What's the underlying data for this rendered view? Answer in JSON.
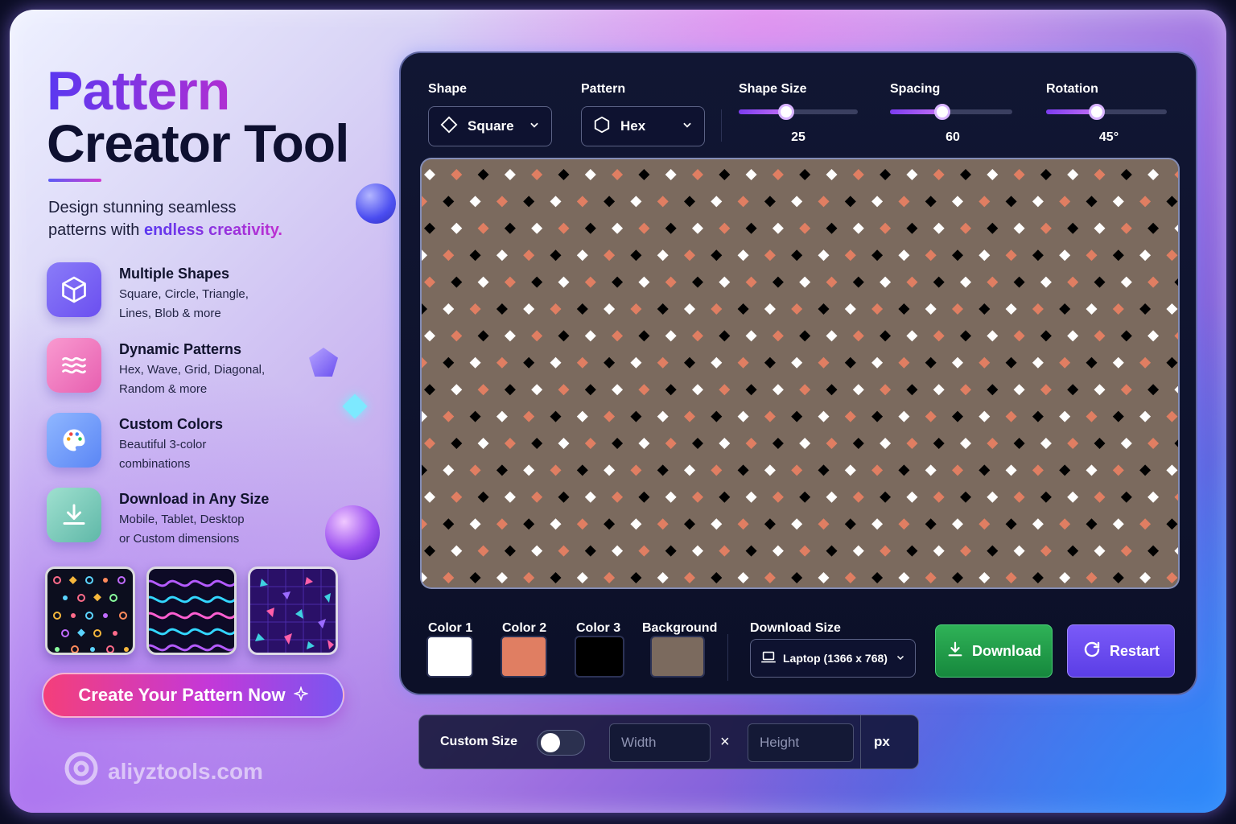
{
  "hero": {
    "title_line1": "Pattern",
    "title_line2": "Creator Tool",
    "subtitle_line1": "Design stunning seamless",
    "subtitle_line2_plain": "patterns with ",
    "subtitle_highlight": "endless creativity."
  },
  "features": [
    {
      "title": "Multiple Shapes",
      "desc1": "Square, Circle, Triangle,",
      "desc2": "Lines, Blob & more",
      "icon": "cube-icon"
    },
    {
      "title": "Dynamic Patterns",
      "desc1": "Hex, Wave, Grid, Diagonal,",
      "desc2": "Random & more",
      "icon": "waves-icon"
    },
    {
      "title": "Custom Colors",
      "desc1": "Beautiful 3-color",
      "desc2": "combinations",
      "icon": "palette-icon"
    },
    {
      "title": "Download in Any Size",
      "desc1": "Mobile, Tablet, Desktop",
      "desc2": "or Custom dimensions",
      "icon": "download-icon"
    }
  ],
  "cta_label": "Create Your Pattern Now",
  "brand": "aliyztools.com",
  "controls": {
    "shape": {
      "label": "Shape",
      "value": "Square"
    },
    "pattern": {
      "label": "Pattern",
      "value": "Hex"
    },
    "shape_size": {
      "label": "Shape Size",
      "value": "25",
      "level": 0.4
    },
    "spacing": {
      "label": "Spacing",
      "value": "60",
      "level": 0.43
    },
    "rotation": {
      "label": "Rotation",
      "value": "45°",
      "level": 0.42
    }
  },
  "colors": {
    "color1": {
      "label": "Color 1",
      "hex": "#ffffff"
    },
    "color2": {
      "label": "Color 2",
      "hex": "#e07e62"
    },
    "color3": {
      "label": "Color 3",
      "hex": "#000000"
    },
    "background": {
      "label": "Background",
      "hex": "#7b6a5e"
    }
  },
  "download": {
    "label": "Download Size",
    "selected": "Laptop (1366 x 768)",
    "download_button": "Download",
    "restart_button": "Restart"
  },
  "custom_size": {
    "label": "Custom Size",
    "width_placeholder": "Width",
    "height_placeholder": "Height",
    "separator": "×",
    "unit": "px"
  }
}
